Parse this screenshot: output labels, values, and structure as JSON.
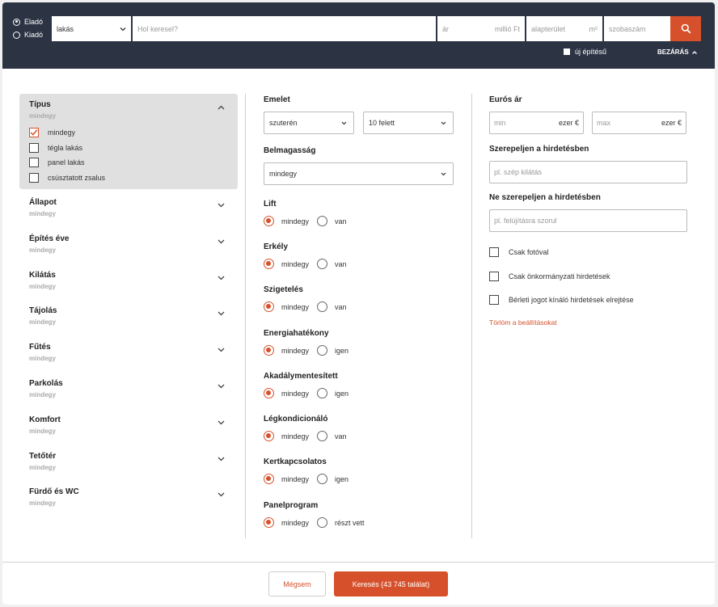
{
  "topbar": {
    "listing_type": [
      {
        "label": "Eladó",
        "selected": true
      },
      {
        "label": "Kiadó",
        "selected": false
      }
    ],
    "property_type": "lakás",
    "search_placeholder": "Hol keresel?",
    "price_placeholder": "ár",
    "price_unit": "millió Ft",
    "area_placeholder": "alapterület",
    "area_unit": "m²",
    "rooms_placeholder": "szobaszám",
    "search_icon": "search-icon",
    "new_build_label": "új építésű",
    "close_label": "BEZÁRÁS"
  },
  "left": {
    "open_section": {
      "title": "Típus",
      "value": "mindegy",
      "options": [
        {
          "label": "mindegy",
          "checked": true
        },
        {
          "label": "tégla lakás",
          "checked": false
        },
        {
          "label": "panel lakás",
          "checked": false
        },
        {
          "label": "csúsztatott zsalus",
          "checked": false
        }
      ]
    },
    "sections": [
      {
        "title": "Állapot",
        "value": "mindegy"
      },
      {
        "title": "Építés éve",
        "value": "mindegy"
      },
      {
        "title": "Kilátás",
        "value": "mindegy"
      },
      {
        "title": "Tájolás",
        "value": "mindegy"
      },
      {
        "title": "Fűtés",
        "value": "mindegy"
      },
      {
        "title": "Parkolás",
        "value": "mindegy"
      },
      {
        "title": "Komfort",
        "value": "mindegy"
      },
      {
        "title": "Tetőtér",
        "value": "mindegy"
      },
      {
        "title": "Fürdő és WC",
        "value": "mindegy"
      }
    ]
  },
  "middle": {
    "floor": {
      "label": "Emelet",
      "from": "szuterén",
      "to": "10 felett"
    },
    "ceiling": {
      "label": "Belmagasság",
      "value": "mindegy"
    },
    "radio_groups": [
      {
        "label": "Lift",
        "options": [
          "mindegy",
          "van"
        ],
        "selected": 0
      },
      {
        "label": "Erkély",
        "options": [
          "mindegy",
          "van"
        ],
        "selected": 0
      },
      {
        "label": "Szigetelés",
        "options": [
          "mindegy",
          "van"
        ],
        "selected": 0
      },
      {
        "label": "Energiahatékony",
        "options": [
          "mindegy",
          "igen"
        ],
        "selected": 0
      },
      {
        "label": "Akadálymentesített",
        "options": [
          "mindegy",
          "igen"
        ],
        "selected": 0
      },
      {
        "label": "Légkondicionáló",
        "options": [
          "mindegy",
          "van"
        ],
        "selected": 0
      },
      {
        "label": "Kertkapcsolatos",
        "options": [
          "mindegy",
          "igen"
        ],
        "selected": 0
      },
      {
        "label": "Panelprogram",
        "options": [
          "mindegy",
          "részt vett"
        ],
        "selected": 0
      }
    ]
  },
  "right": {
    "euro_price": {
      "label": "Eurós ár",
      "min_placeholder": "min",
      "max_placeholder": "max",
      "unit": "ezer €"
    },
    "include": {
      "label": "Szerepeljen a hirdetésben",
      "placeholder": "pl. szép kilátás"
    },
    "exclude": {
      "label": "Ne szerepeljen a hirdetésben",
      "placeholder": "pl. felújításra szorul"
    },
    "checkboxes": [
      {
        "label": "Csak fotóval",
        "checked": false
      },
      {
        "label": "Csak önkormányzati hirdetések",
        "checked": false
      },
      {
        "label": "Bérleti jogot kínáló hirdetések elrejtése",
        "checked": false
      }
    ],
    "reset_label": "Törlöm a beállításokat"
  },
  "footer": {
    "cancel_label": "Mégsem",
    "search_label": "Keresés (43 745 találat)"
  },
  "colors": {
    "accent": "#d6512b",
    "topbar": "#2c3443"
  }
}
